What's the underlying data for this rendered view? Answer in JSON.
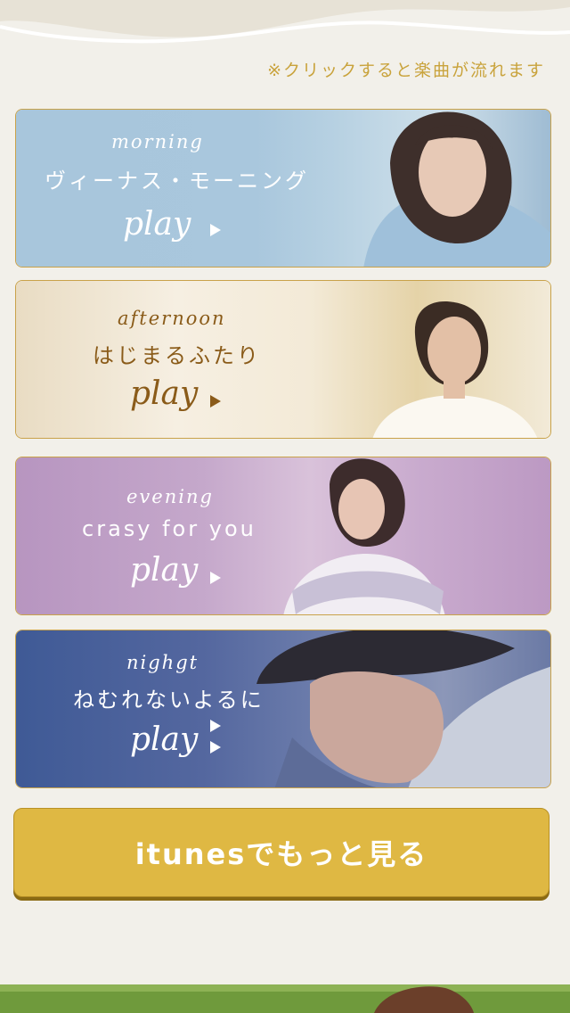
{
  "note": "※クリックすると楽曲が流れます",
  "tracks": [
    {
      "period": "morning",
      "title": "ヴィーナス・モーニング",
      "play": "play"
    },
    {
      "period": "afternoon",
      "title": "はじまるふたり",
      "play": "play"
    },
    {
      "period": "evening",
      "title": "crasy for you",
      "play": "play"
    },
    {
      "period": "nighgt",
      "title": "ねむれないよるに",
      "play": "play"
    }
  ],
  "itunes_label": "itunesでもっと見る",
  "colors": {
    "accent_gold": "#dfb843",
    "note_text": "#c9a33c",
    "afternoon_text": "#8a5b19",
    "page_bg": "#f2f0ea"
  }
}
